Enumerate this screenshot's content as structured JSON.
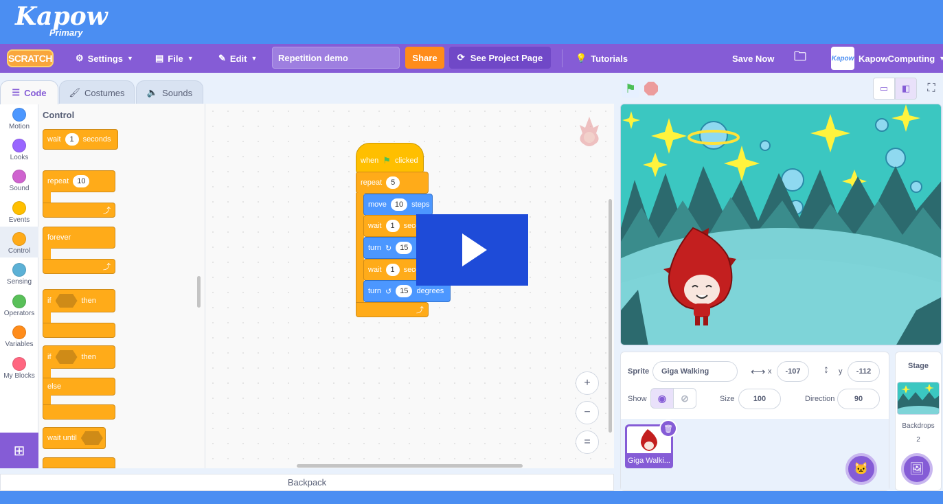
{
  "brand": {
    "logo": "Kapow",
    "sub": "Primary"
  },
  "menu": {
    "scratch_logo": "SCRATCH",
    "settings": "Settings",
    "file": "File",
    "edit": "Edit",
    "project_title": "Repetition demo",
    "share": "Share",
    "see_project": "See Project Page",
    "tutorials": "Tutorials",
    "save_now": "Save Now",
    "username": "KapowComputing",
    "avatar_text": "Kapow"
  },
  "tabs": {
    "code": "Code",
    "costumes": "Costumes",
    "sounds": "Sounds"
  },
  "categories": [
    {
      "label": "Motion",
      "color": "#4c97ff"
    },
    {
      "label": "Looks",
      "color": "#9966ff"
    },
    {
      "label": "Sound",
      "color": "#cf63cf"
    },
    {
      "label": "Events",
      "color": "#ffbf00"
    },
    {
      "label": "Control",
      "color": "#ffab19"
    },
    {
      "label": "Sensing",
      "color": "#5cb1d6"
    },
    {
      "label": "Operators",
      "color": "#59c059"
    },
    {
      "label": "Variables",
      "color": "#ff8c1a"
    },
    {
      "label": "My Blocks",
      "color": "#ff6680"
    }
  ],
  "palette": {
    "title": "Control",
    "wait_label": "wait",
    "wait_value": "1",
    "wait_unit": "seconds",
    "repeat_label": "repeat",
    "repeat_value": "10",
    "forever_label": "forever",
    "if_label": "if",
    "then_label": "then",
    "else_label": "else",
    "wait_until_label": "wait until"
  },
  "script": {
    "hat_when": "when",
    "hat_clicked": "clicked",
    "repeat_label": "repeat",
    "repeat_value": "5",
    "move_label": "move",
    "move_value": "10",
    "move_unit": "steps",
    "wait1_label": "wait",
    "wait1_value": "1",
    "wait1_unit": "seconds",
    "turn_right_label": "turn",
    "turn_right_value": "15",
    "wait2_label": "wait",
    "wait2_value": "1",
    "wait2_unit": "seconds",
    "turn_left_label": "turn",
    "turn_left_value": "15",
    "turn_left_unit": "degrees"
  },
  "zoom": {
    "in": "+",
    "out": "−",
    "reset": "="
  },
  "backpack": "Backpack",
  "sprite_info": {
    "sprite_label": "Sprite",
    "sprite_name": "Giga Walking",
    "x_label": "x",
    "x_value": "-107",
    "y_label": "y",
    "y_value": "-112",
    "show_label": "Show",
    "size_label": "Size",
    "size_value": "100",
    "direction_label": "Direction",
    "direction_value": "90"
  },
  "sprite_list": {
    "thumb_label": "Giga Walki..."
  },
  "stage_pane": {
    "title": "Stage",
    "backdrops_label": "Backdrops",
    "backdrops_count": "2"
  },
  "colors": {
    "accent": "#855cd6",
    "brand": "#4b8ef2",
    "control": "#ffab19",
    "motion": "#4c97ff"
  }
}
